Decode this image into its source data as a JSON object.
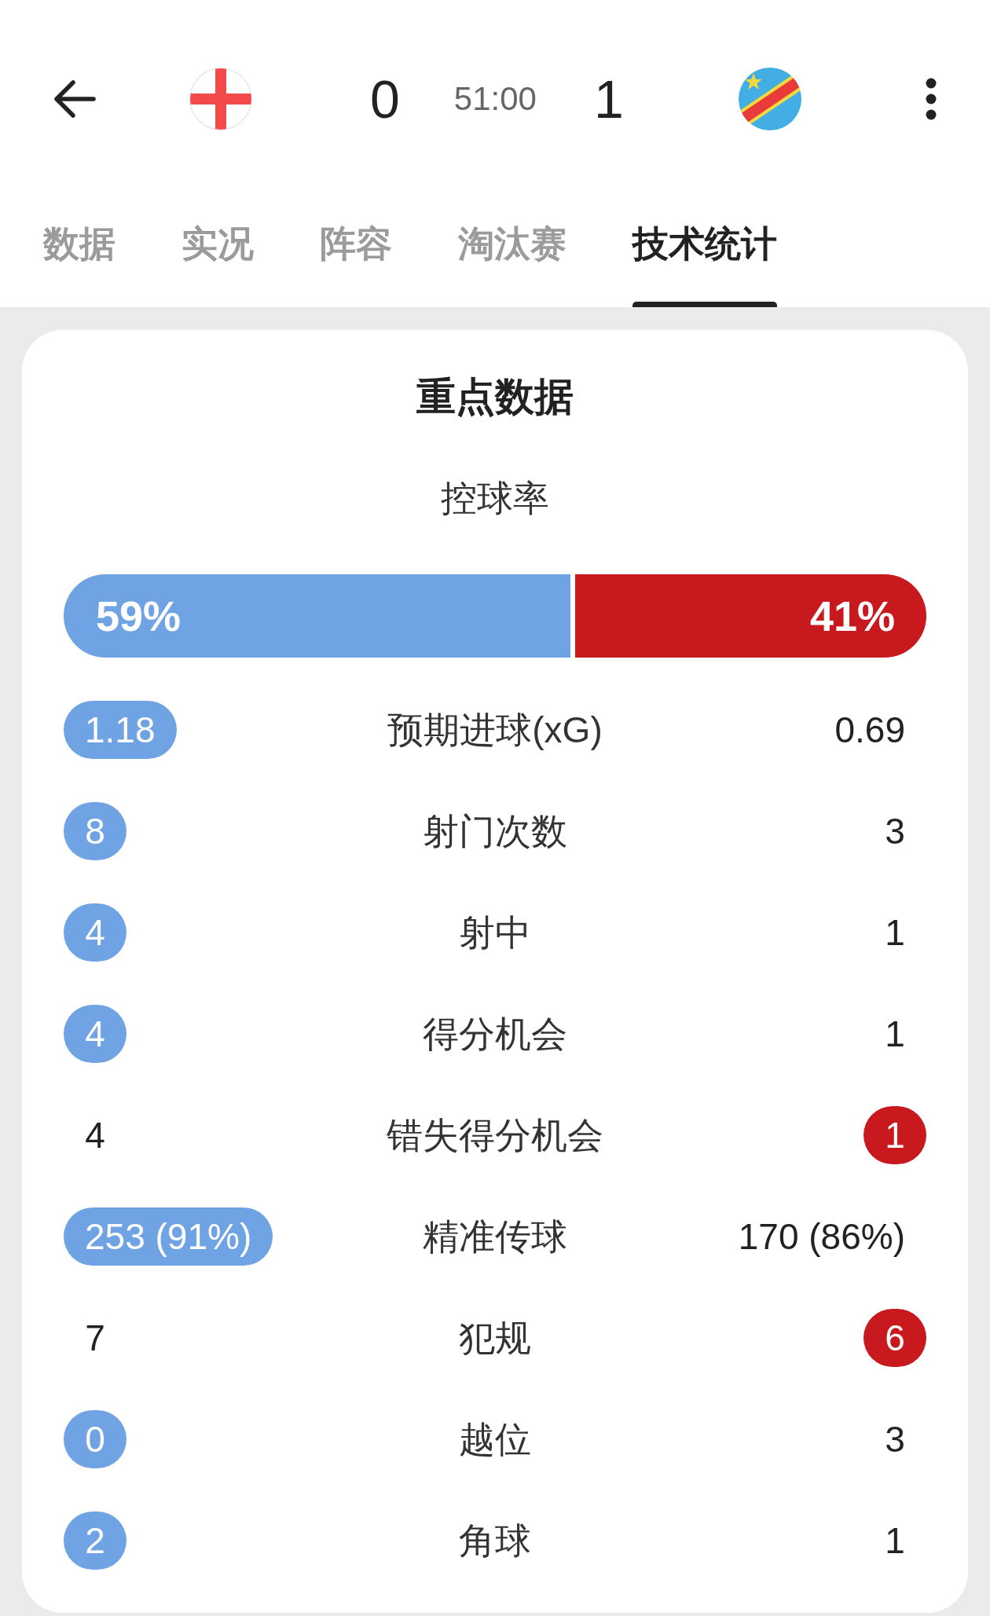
{
  "header": {
    "home_score": "0",
    "clock": "51:00",
    "away_score": "1"
  },
  "tabs": [
    {
      "label": "数据",
      "selected": false
    },
    {
      "label": "实况",
      "selected": false
    },
    {
      "label": "阵容",
      "selected": false
    },
    {
      "label": "淘汰赛",
      "selected": false
    },
    {
      "label": "技术统计",
      "selected": true
    }
  ],
  "key_stats": {
    "title": "重点数据",
    "possession": {
      "label": "控球率",
      "home": "59%",
      "away": "41%",
      "level": 0.59
    },
    "rows": [
      {
        "label": "预期进球(xG)",
        "home": {
          "value": "1.18",
          "highlighted": true
        },
        "away": {
          "value": "0.69",
          "highlighted": false
        }
      },
      {
        "label": "射门次数",
        "home": {
          "value": "8",
          "highlighted": true
        },
        "away": {
          "value": "3",
          "highlighted": false
        }
      },
      {
        "label": "射中",
        "home": {
          "value": "4",
          "highlighted": true
        },
        "away": {
          "value": "1",
          "highlighted": false
        }
      },
      {
        "label": "得分机会",
        "home": {
          "value": "4",
          "highlighted": true
        },
        "away": {
          "value": "1",
          "highlighted": false
        }
      },
      {
        "label": "错失得分机会",
        "home": {
          "value": "4",
          "highlighted": false
        },
        "away": {
          "value": "1",
          "highlighted": true
        }
      },
      {
        "label": "精准传球",
        "home": {
          "value": "253 (91%)",
          "highlighted": true
        },
        "away": {
          "value": "170 (86%)",
          "highlighted": false
        }
      },
      {
        "label": "犯规",
        "home": {
          "value": "7",
          "highlighted": false
        },
        "away": {
          "value": "6",
          "highlighted": true
        }
      },
      {
        "label": "越位",
        "home": {
          "value": "0",
          "highlighted": true
        },
        "away": {
          "value": "3",
          "highlighted": false
        }
      },
      {
        "label": "角球",
        "home": {
          "value": "2",
          "highlighted": true
        },
        "away": {
          "value": "1",
          "highlighted": false
        }
      }
    ]
  }
}
